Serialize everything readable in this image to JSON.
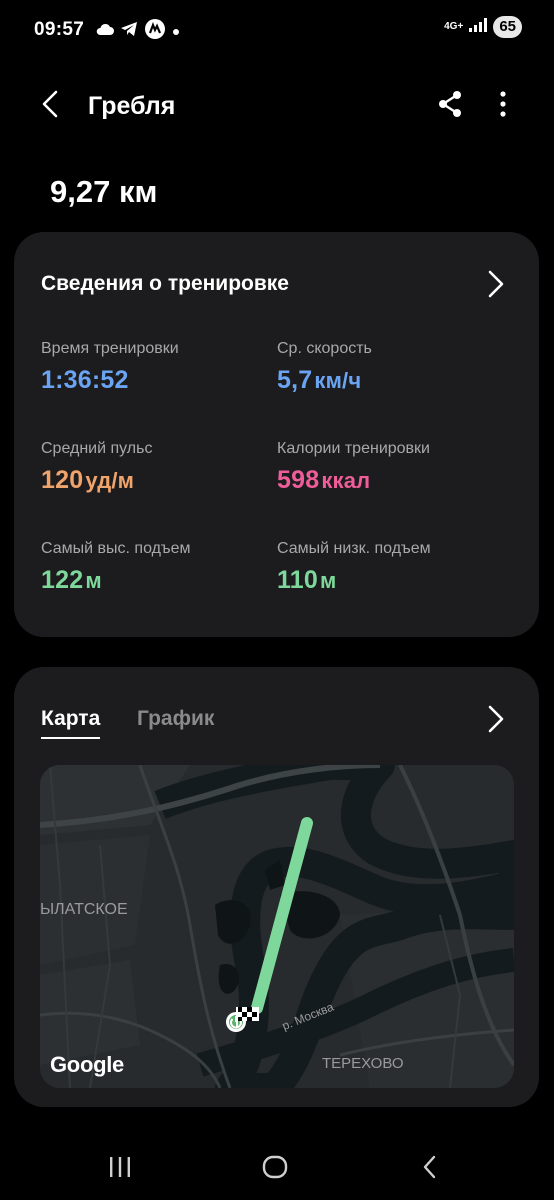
{
  "status_bar": {
    "time": "09:57",
    "network": "4G+",
    "battery": "65",
    "icons": [
      "cloud-icon",
      "telegram-icon",
      "app-icon",
      "dot-icon",
      "signal-icon"
    ]
  },
  "header": {
    "title": "Гребля",
    "icons": [
      "back-icon",
      "share-icon",
      "more-icon"
    ]
  },
  "summary": {
    "distance": "9,27 км"
  },
  "workout_details": {
    "title": "Сведения о тренировке",
    "stats": [
      {
        "label": "Время тренировки",
        "value": "1:36:52",
        "unit": "",
        "color": "#6aa4f2"
      },
      {
        "label": "Ср. скорость",
        "value": "5,7",
        "unit": "км/ч",
        "color": "#6aa4f2"
      },
      {
        "label": "Средний пульс",
        "value": "120",
        "unit": "уд/м",
        "color": "#f0a36a"
      },
      {
        "label": "Калории тренировки",
        "value": "598",
        "unit": "ккал",
        "color": "#ee5d99"
      },
      {
        "label": "Самый выс. подъем",
        "value": "122",
        "unit": "м",
        "color": "#7fd89b"
      },
      {
        "label": "Самый низк. подъем",
        "value": "110",
        "unit": "м",
        "color": "#7fd89b"
      }
    ]
  },
  "map_card": {
    "tabs": [
      {
        "label": "Карта",
        "active": true
      },
      {
        "label": "График",
        "active": false
      }
    ],
    "map_labels": {
      "district_left": "ЫЛАТСКОЕ",
      "river": "р. Москва",
      "district_bottom": "ТЕРЕХОВО"
    },
    "attribution": "Google",
    "route_color": "#7fd89b"
  },
  "nav_bar": {
    "icons": [
      "recent-apps-icon",
      "home-icon",
      "back-nav-icon"
    ]
  }
}
